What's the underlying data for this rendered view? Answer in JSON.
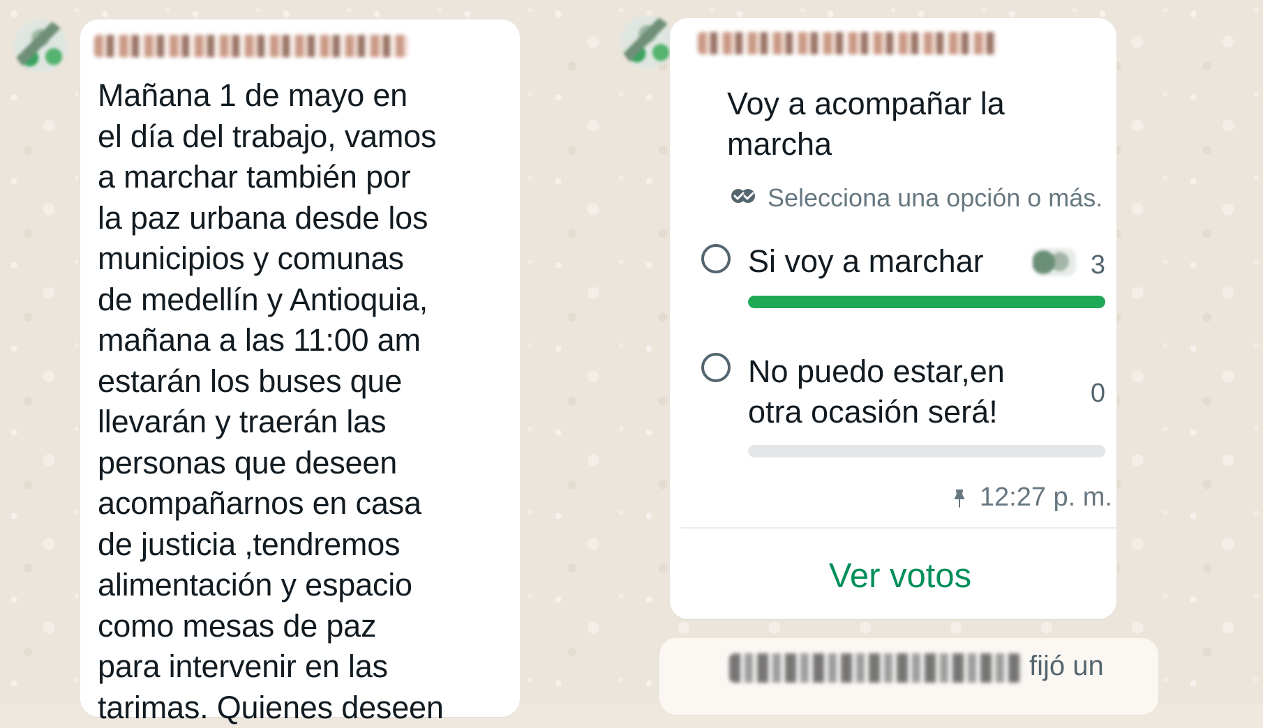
{
  "left_message": {
    "text": "Mañana 1 de mayo en\nel día del trabajo, vamos\na marchar también por\nla paz urbana desde los\nmunicipios y comunas\nde medellín y Antioquia,\nmañana a las 11:00 am\nestarán los buses que\nllevarán y traerán las\npersonas que deseen\nacompañarnos en casa\nde justicia ,tendremos\nalimentación y espacio\ncomo mesas de paz\npara intervenir en las\ntarimas. Quienes deseen"
  },
  "poll": {
    "question": "Voy a acompañar la\nmarcha",
    "instruction": "Selecciona una opción o más.",
    "options": [
      {
        "label": "Si voy a marchar",
        "count": "3",
        "progress": 1
      },
      {
        "label": "No puedo estar,en\notra ocasión será!",
        "count": "0",
        "progress": 0
      }
    ],
    "time": "12:27 p. m.",
    "view_votes_label": "Ver votos"
  },
  "system_message": {
    "text": "fijó un"
  },
  "colors": {
    "accent_green": "#1fa855",
    "link_green": "#008f5a",
    "muted_text": "#667781"
  }
}
